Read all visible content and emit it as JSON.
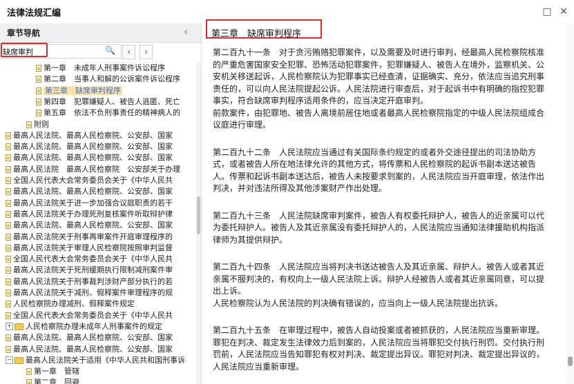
{
  "window": {
    "title": "法律法规汇编",
    "restore_icon": "□",
    "close_icon": "✕"
  },
  "sidebar": {
    "title": "章节导航",
    "collapse_icon": "‹",
    "search": {
      "value": "缺席审判",
      "icon": "search-icon"
    },
    "prev_icon": "‹",
    "next_icon": "›",
    "tree": [
      {
        "indent": 52,
        "icon": "doc",
        "text": "第一章　未成年人刑事案件诉讼程序"
      },
      {
        "indent": 52,
        "icon": "doc",
        "text": "第二章　当事人和解的公诉案件诉讼程序"
      },
      {
        "indent": 52,
        "icon": "doc",
        "text": "第三章　缺席审判程序",
        "selected": true
      },
      {
        "indent": 52,
        "icon": "doc",
        "text": "第四章　犯罪嫌疑人、被告人逃匿、死亡"
      },
      {
        "indent": 52,
        "icon": "doc",
        "text": "第五章　依法不负刑事责任的精神病人的"
      },
      {
        "indent": 38,
        "icon": "doc",
        "text": "附则"
      },
      {
        "indent": 8,
        "icon": "doc",
        "text": "最高人民法院、最高人民检察院、公安部、国家"
      },
      {
        "indent": 8,
        "icon": "doc",
        "text": "最高人民法院、最高人民检察院、公安部、国家"
      },
      {
        "indent": 8,
        "icon": "doc",
        "text": "最高人民法院、最高人民检察院、公安部、国家"
      },
      {
        "indent": 8,
        "icon": "doc",
        "text": "最高人民法院　最高人民检察院　公安部关于办理"
      },
      {
        "indent": 8,
        "icon": "doc",
        "text": "全国人民代表大会常务委员会关于《中华人民共"
      },
      {
        "indent": 8,
        "icon": "doc",
        "text": "最高人民法院、最高人民检察院、公安部、国家"
      },
      {
        "indent": 8,
        "icon": "doc",
        "text": "最高人民法院关于进一步加强合议庭职责的若干"
      },
      {
        "indent": 8,
        "icon": "doc",
        "text": "最高人民法院关于办理死刑复核案件听取辩护律"
      },
      {
        "indent": 8,
        "icon": "doc",
        "text": "最高人民法院、最高人民检察院、公安部、国家"
      },
      {
        "indent": 8,
        "icon": "doc",
        "text": "最高人民法院关于刑事再审案件开庭审理程序的"
      },
      {
        "indent": 8,
        "icon": "doc",
        "text": "最高人民法院关于审理人民检察院按照审判监督"
      },
      {
        "indent": 8,
        "icon": "doc",
        "text": "全国人民代表大会常务委员会关于《中华人民共"
      },
      {
        "indent": 8,
        "icon": "doc",
        "text": "最高人民法院关于死刑缓期执行限制减刑案件审"
      },
      {
        "indent": 8,
        "icon": "doc",
        "text": "最高人民法院关于刑事裁判涉财产部分执行的若"
      },
      {
        "indent": 8,
        "icon": "doc",
        "text": "最高人民法院关于减刑、假释案件审理程序的规"
      },
      {
        "indent": 8,
        "icon": "doc",
        "text": "人民检察院办理减刑、假释案件规定"
      },
      {
        "indent": 8,
        "icon": "doc",
        "text": "全国人民代表大会常务委员会关于《中华人民共"
      },
      {
        "indent": 8,
        "icon": "folder",
        "expander": "+",
        "text": "人民检察院办理未成年人刑事案件的规定"
      },
      {
        "indent": 8,
        "icon": "doc",
        "text": "最高人民法院、最高人民检察院、公安部、国家"
      },
      {
        "indent": 8,
        "icon": "doc",
        "text": "最高人民法院、最高人民检察院、公安部、国家"
      },
      {
        "indent": 8,
        "icon": "folder",
        "expander": "−",
        "text": "最高人民法院关于适用《中华人民共和国刑事诉"
      },
      {
        "indent": 38,
        "icon": "doc",
        "text": "第一章　管辖"
      },
      {
        "indent": 38,
        "icon": "doc",
        "text": "第二章　回避"
      },
      {
        "indent": 38,
        "icon": "doc",
        "text": "第三章　辩护与代理"
      }
    ]
  },
  "main": {
    "chapter_title": "第三章　缺席审判程序",
    "paragraphs": [
      {
        "text": "第二百九十一条　对于贪污贿赂犯罪案件，以及需要及时进行审判，经最高人民检察院核准的严重危害国家安全犯罪、恐怖活动犯罪案件，犯罪嫌疑人、被告人在境外，监察机关、公安机关移送起诉，人民检察院认为犯罪事实已经查清，证据确实、充分，依法应当追究刑事责任的，可以向人民法院提起公诉。人民法院进行审查后，对于起诉书中有明确的指控犯罪事实，符合缺席审判程序适用条件的，应当决定开庭审判。"
      },
      {
        "text": "前款案件，由犯罪地、被告人离境前居住地或者最高人民检察院指定的中级人民法院组成合议庭进行审理。"
      },
      {
        "gap": true
      },
      {
        "text": "第二百九十二条　人民法院应当通过有关国际条约规定的或者外交途径提出的司法协助方式，或者被告人所在地法律允许的其他方式，将传票和人民检察院的起诉书副本送达被告人。传票和起诉书副本送达后，被告人未按要求到案的，人民法院应当开庭审理，依法作出判决，并对违法所得及其他涉案财产作出处理。"
      },
      {
        "gap": true
      },
      {
        "text": "第二百九十三条　人民法院缺席审判案件，被告人有权委托辩护人，被告人的近亲属可以代为委托辩护人。被告人及其近亲属没有委托辩护人的，人民法院应当通知法律援助机构指派律师为其提供辩护。"
      },
      {
        "gap": true
      },
      {
        "text": "第二百九十四条　人民法院应当将判决书送达被告人及其近亲属、辩护人。被告人或者其近亲属不服判决的，有权向上一级人民法院上诉。辩护人经被告人或者其近亲属同意，可以提出上诉。"
      },
      {
        "text": "人民检察院认为人民法院的判决确有错误的，应当向上一级人民法院提出抗诉。"
      },
      {
        "gap": true
      },
      {
        "text": "第二百九十五条　在审理过程中，被告人自动投案或者被抓获的，人民法院应当重新审理。"
      },
      {
        "text": "罪犯在判决、裁定发生法律效力后到案的，人民法院应当将罪犯交付执行刑罚。交付执行刑罚前，人民法院应当告知罪犯有权对判决、裁定提出异议。罪犯对判决、裁定提出异议的，人民法院应当重新审理。"
      }
    ]
  }
}
